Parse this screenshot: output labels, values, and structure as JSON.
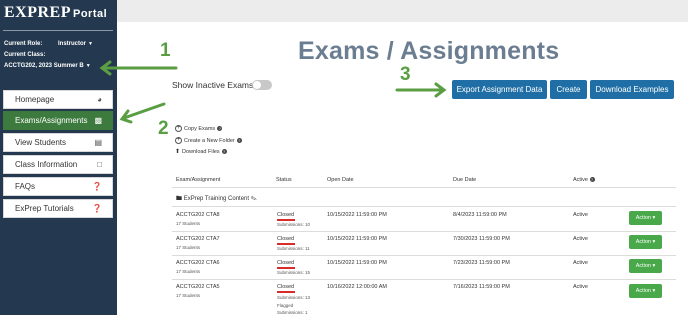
{
  "sidebar": {
    "brand": "EXPREP",
    "brand_suffix": "Portal",
    "role_label": "Current Role:",
    "role_value": "Instructor",
    "class_label": "Current Class:",
    "class_value": "ACCTG202, 2023 Summer B",
    "items": [
      {
        "label": "Homepage",
        "icon": "dashboard-icon"
      },
      {
        "label": "Exams/Assignments",
        "icon": "file-icon"
      },
      {
        "label": "View Students",
        "icon": "institution-icon"
      },
      {
        "label": "Class Information",
        "icon": "folder-icon"
      },
      {
        "label": "FAQs",
        "icon": "question-circle-icon"
      },
      {
        "label": "ExPrep Tutorials",
        "icon": "question-circle-icon"
      }
    ]
  },
  "main": {
    "title": "Exams / Assignments",
    "toggle_label": "Show Inactive Exams",
    "buttons": {
      "export": "Export Assignment Data",
      "create": "Create",
      "download": "Download Examples"
    },
    "actions": {
      "copy": "Copy Exams",
      "new_folder": "Create a New Folder",
      "download_files": "Download Files"
    }
  },
  "table": {
    "headers": [
      "Exam/Assignment",
      "Status",
      "Open Date",
      "Due Date",
      "Active"
    ],
    "folder": "ExPrep Training Content",
    "rows": [
      {
        "name": "ACCTG202 CTA8",
        "students": "17 Students",
        "status": "Closed",
        "submissions": "Submissions: 10",
        "open": "10/15/2022 11:59:00 PM",
        "due": "8/4/2023 11:59:00 PM",
        "active": "Active",
        "action": "Action"
      },
      {
        "name": "ACCTG202 CTA7",
        "students": "17 Students",
        "status": "Closed",
        "submissions": "Submissions: 11",
        "open": "10/15/2022 11:59:00 PM",
        "due": "7/30/2023 11:59:00 PM",
        "active": "Active",
        "action": "Action"
      },
      {
        "name": "ACCTG202 CTA6",
        "students": "17 Students",
        "status": "Closed",
        "submissions": "Submissions: 15",
        "open": "10/15/2022 11:59:00 PM",
        "due": "7/23/2023 11:59:00 PM",
        "active": "Active",
        "action": "Action"
      },
      {
        "name": "ACCTG202 CTA5",
        "students": "17 Students",
        "status": "Closed",
        "submissions": "Submissions: 13",
        "flagged": "Flagged",
        "flagged_sub": "Submissions: 1",
        "open": "10/16/2022 12:00:00 AM",
        "due": "7/16/2023 11:59:00 PM",
        "active": "Active",
        "action": "Action"
      }
    ]
  },
  "annotations": {
    "one": "1",
    "two": "2",
    "three": "3",
    "color": "#5a9e43"
  },
  "colors": {
    "sidebar": "#24394f",
    "active_nav": "#3d7a3e",
    "primary_button": "#1f6fa6",
    "action_button": "#49a94a",
    "closed_marker": "#d92b2b"
  }
}
